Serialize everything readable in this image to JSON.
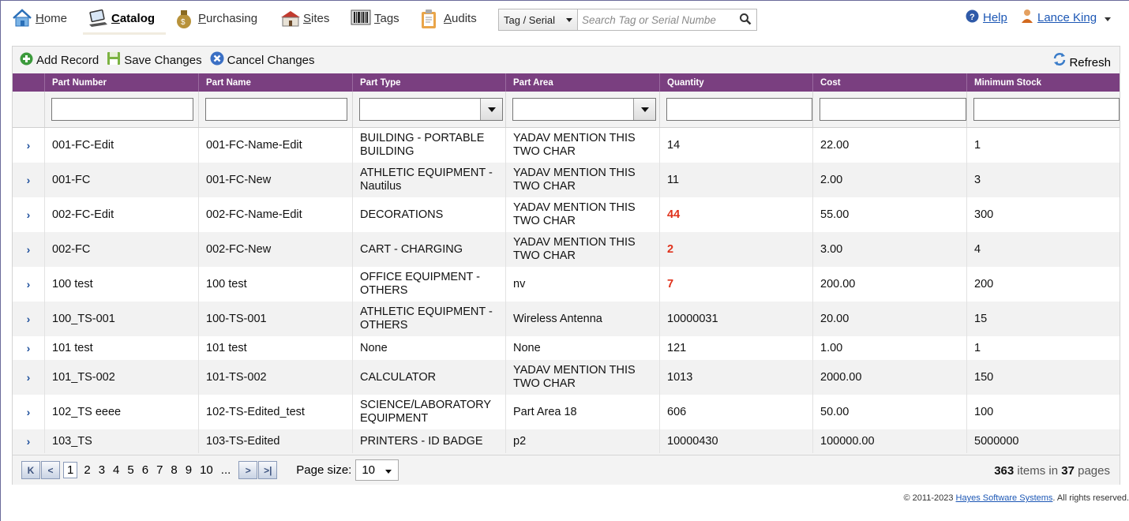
{
  "nav": {
    "items": [
      {
        "label": "Home",
        "icon": "home-icon"
      },
      {
        "label": "Catalog",
        "icon": "laptop-icon"
      },
      {
        "label": "Purchasing",
        "icon": "money-bag-icon"
      },
      {
        "label": "Sites",
        "icon": "school-icon"
      },
      {
        "label": "Tags",
        "icon": "barcode-icon"
      },
      {
        "label": "Audits",
        "icon": "clipboard-icon"
      }
    ],
    "active": "Catalog",
    "search": {
      "type_selected": "Tag / Serial",
      "placeholder": "Search Tag or Serial Numbe"
    },
    "help_label": "Help",
    "user_name": "Lance King"
  },
  "toolbar": {
    "add_label": "Add Record",
    "save_label": "Save Changes",
    "cancel_label": "Cancel Changes",
    "refresh_label": "Refresh"
  },
  "grid": {
    "columns": [
      "Part Number",
      "Part Name",
      "Part Type",
      "Part Area",
      "Quantity",
      "Cost",
      "Minimum Stock"
    ],
    "rows": [
      {
        "part_number": "001-FC-Edit",
        "part_name": "001-FC-Name-Edit",
        "part_type": "BUILDING - PORTABLE BUILDING",
        "part_area": "YADAV MENTION THIS TWO CHAR",
        "quantity": "14",
        "cost": "22.00",
        "minimum_stock": "1",
        "low": false
      },
      {
        "part_number": "001-FC",
        "part_name": "001-FC-New",
        "part_type": "ATHLETIC EQUIPMENT - Nautilus",
        "part_area": "YADAV MENTION THIS TWO CHAR",
        "quantity": "11",
        "cost": "2.00",
        "minimum_stock": "3",
        "low": false
      },
      {
        "part_number": "002-FC-Edit",
        "part_name": "002-FC-Name-Edit",
        "part_type": "DECORATIONS",
        "part_area": "YADAV MENTION THIS TWO CHAR",
        "quantity": "44",
        "cost": "55.00",
        "minimum_stock": "300",
        "low": true
      },
      {
        "part_number": "002-FC",
        "part_name": "002-FC-New",
        "part_type": "CART - CHARGING",
        "part_area": "YADAV MENTION THIS TWO CHAR",
        "quantity": "2",
        "cost": "3.00",
        "minimum_stock": "4",
        "low": true
      },
      {
        "part_number": "100 test",
        "part_name": "100 test",
        "part_type": "OFFICE EQUIPMENT - OTHERS",
        "part_area": "nv",
        "quantity": "7",
        "cost": "200.00",
        "minimum_stock": "200",
        "low": true
      },
      {
        "part_number": "100_TS-001",
        "part_name": "100-TS-001",
        "part_type": "ATHLETIC EQUIPMENT - OTHERS",
        "part_area": "Wireless Antenna",
        "quantity": "10000031",
        "cost": "20.00",
        "minimum_stock": "15",
        "low": false
      },
      {
        "part_number": "101 test",
        "part_name": "101 test",
        "part_type": "None",
        "part_area": "None",
        "quantity": "121",
        "cost": "1.00",
        "minimum_stock": "1",
        "low": false
      },
      {
        "part_number": "101_TS-002",
        "part_name": "101-TS-002",
        "part_type": "CALCULATOR",
        "part_area": "YADAV MENTION THIS TWO CHAR",
        "quantity": "1013",
        "cost": "2000.00",
        "minimum_stock": "150",
        "low": false
      },
      {
        "part_number": "102_TS eeee",
        "part_name": "102-TS-Edited_test",
        "part_type": "SCIENCE/LABORATORY EQUIPMENT",
        "part_area": "Part Area 18",
        "quantity": "606",
        "cost": "50.00",
        "minimum_stock": "100",
        "low": false
      },
      {
        "part_number": "103_TS",
        "part_name": "103-TS-Edited",
        "part_type": "PRINTERS - ID BADGE",
        "part_area": "p2",
        "quantity": "10000430",
        "cost": "100000.00",
        "minimum_stock": "5000000",
        "low": false
      }
    ]
  },
  "pager": {
    "pages": [
      "1",
      "2",
      "3",
      "4",
      "5",
      "6",
      "7",
      "8",
      "9",
      "10",
      "..."
    ],
    "current": "1",
    "page_size_label": "Page size:",
    "page_size": "10",
    "total_items": "363",
    "items_in_text": "items in",
    "total_pages": "37",
    "pages_text": "pages"
  },
  "footer": {
    "prefix": "© 2011-2023",
    "company": "Hayes Software Systems",
    "suffix": ". All rights reserved."
  },
  "colors": {
    "header_bg": "#7a3f80",
    "link": "#1c57b5",
    "low_stock": "#e0321c",
    "expander": "#1e4f9c"
  }
}
